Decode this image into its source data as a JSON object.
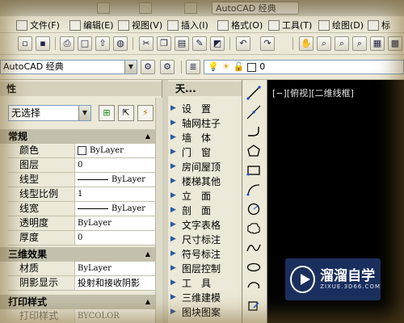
{
  "window": {
    "title": "AutoCAD 经典"
  },
  "menubar": {
    "items": [
      {
        "label": "文件(F)",
        "icon": "file-icon"
      },
      {
        "label": "编辑(E)",
        "icon": "edit-icon"
      },
      {
        "label": "视图(V)",
        "icon": "view-icon"
      },
      {
        "label": "插入(I)",
        "icon": "insert-icon"
      },
      {
        "label": "格式(O)",
        "icon": "format-icon"
      },
      {
        "label": "工具(T)",
        "icon": "tools-icon"
      },
      {
        "label": "绘图(D)",
        "icon": "draw-icon"
      },
      {
        "label": "标",
        "icon": "dimension-icon"
      }
    ]
  },
  "toolbar": {
    "workspace": "AutoCAD 经典",
    "layer_value": "0"
  },
  "properties": {
    "title": "性",
    "selection": "无选择",
    "sections": {
      "general": "常规",
      "three_d": "三维效果",
      "plot": "打印样式"
    },
    "general_rows": [
      {
        "name": "颜色",
        "value": "ByLayer"
      },
      {
        "name": "图层",
        "value": "0"
      },
      {
        "name": "线型",
        "value": "ByLayer"
      },
      {
        "name": "线型比例",
        "value": "1"
      },
      {
        "name": "线宽",
        "value": "ByLayer"
      },
      {
        "name": "透明度",
        "value": "ByLayer"
      },
      {
        "name": "厚度",
        "value": "0"
      }
    ],
    "three_d_rows": [
      {
        "name": "材质",
        "value": "ByLayer"
      },
      {
        "name": "阴影显示",
        "value": "投射和接收阴影"
      }
    ],
    "plot_rows": [
      {
        "name": "打印样式",
        "value": "BYCOLOR"
      }
    ]
  },
  "palette": {
    "title": "天...",
    "items": [
      "设　置",
      "轴网柱子",
      "墙　体",
      "门　窗",
      "房间屋顶",
      "楼梯其他",
      "立　面",
      "剖　面",
      "文字表格",
      "尺寸标注",
      "符号标注",
      "图层控制",
      "工　具",
      "三维建模",
      "图块图案"
    ]
  },
  "viewport": {
    "label": "[−][俯视][二维线框]"
  },
  "watermark": {
    "text": "溜溜自学",
    "sub": "ZIXUE.3D66.COM"
  }
}
